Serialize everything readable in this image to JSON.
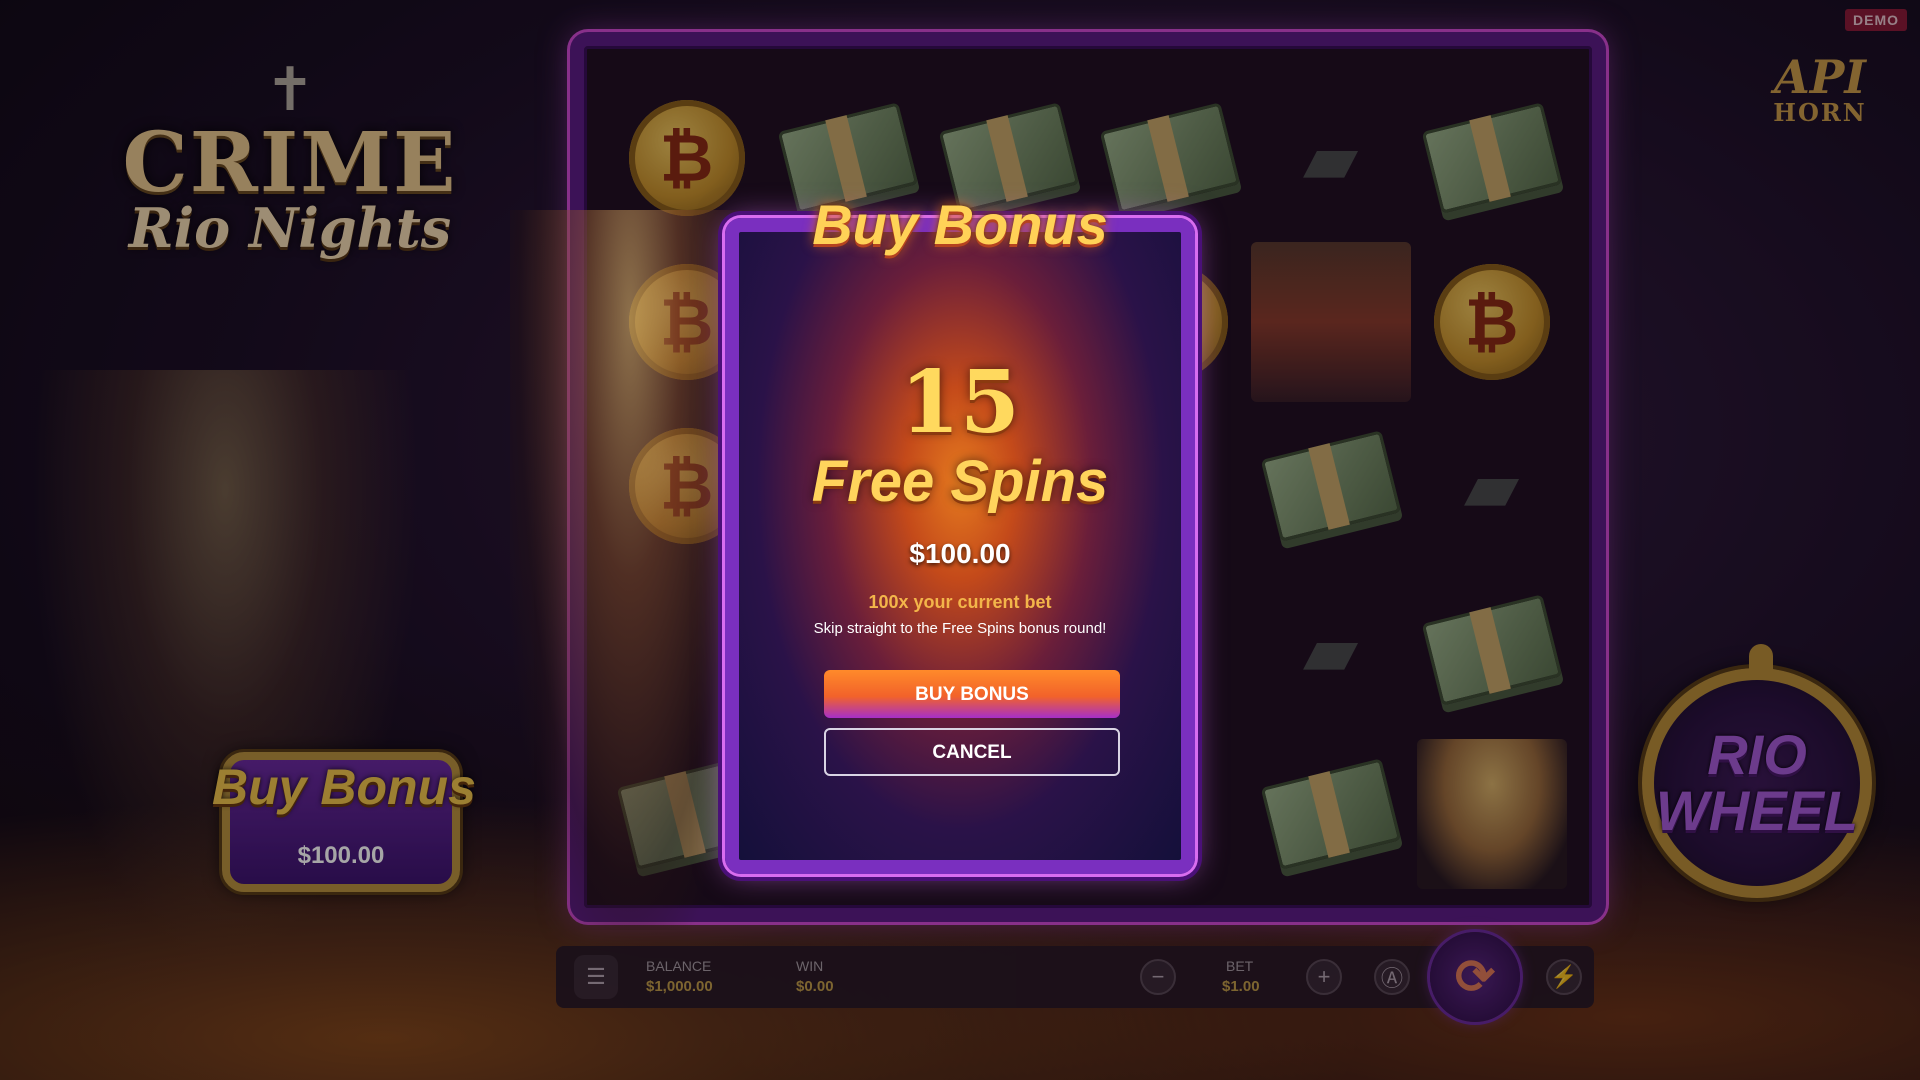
{
  "badge": {
    "demo": "DEMO"
  },
  "logo": {
    "line1": "CRIME",
    "line2": "Rio Nights"
  },
  "provider_logo": {
    "top": "API",
    "bottom": "HORN"
  },
  "side_buy_bonus": {
    "title": "Buy Bonus",
    "price": "$100.00"
  },
  "reels": {
    "rows": [
      [
        "coin",
        "cash",
        "cash",
        "cash",
        "gun",
        "cash"
      ],
      [
        "coin",
        "",
        "",
        "coin",
        "man",
        "coin"
      ],
      [
        "coin",
        "",
        "",
        "",
        "cash",
        "gun"
      ],
      [
        "",
        "",
        "",
        "",
        "gun",
        "cash"
      ],
      [
        "cash",
        "",
        "",
        "",
        "cash",
        "woman"
      ]
    ],
    "coin_glyph": "₿"
  },
  "rio_wheel": {
    "line1": "RIO",
    "line2": "WHEEL"
  },
  "controls": {
    "balance_label": "BALANCE",
    "balance_value": "$1,000.00",
    "win_label": "WIN",
    "win_value": "$0.00",
    "bet_label": "BET",
    "bet_value": "$1.00",
    "menu_icon": "hamburger-icon",
    "minus_icon": "minus-icon",
    "plus_icon": "plus-icon",
    "autoplay_icon": "autoplay-icon",
    "turbo_icon": "lightning-icon",
    "spin_icon": "refresh-icon"
  },
  "modal": {
    "title": "Buy Bonus",
    "count": "15",
    "label": "Free Spins",
    "price": "$100.00",
    "multiplier_text": "100x your current bet",
    "description": "Skip straight to the Free Spins bonus round!",
    "buy_label": "BUY BONUS",
    "cancel_label": "CANCEL"
  }
}
